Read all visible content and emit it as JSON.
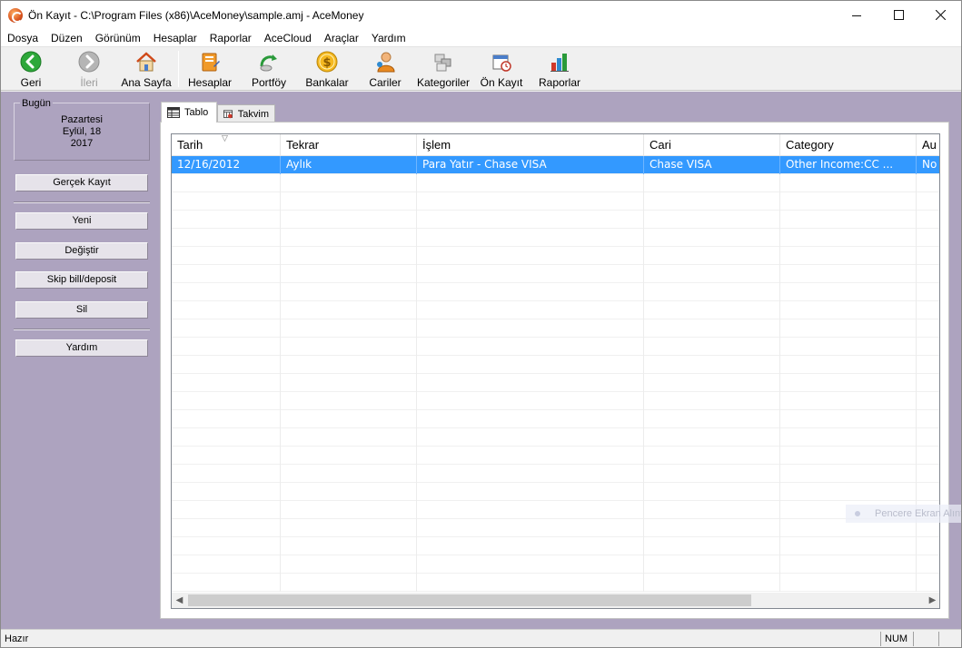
{
  "window": {
    "title": "Ön Kayıt - C:\\Program Files (x86)\\AceMoney\\sample.amj - AceMoney"
  },
  "menu": [
    "Dosya",
    "Düzen",
    "Görünüm",
    "Hesaplar",
    "Raporlar",
    "AceCloud",
    "Araçlar",
    "Yardım"
  ],
  "toolbar": {
    "back": "Geri",
    "forward": "İleri",
    "home": "Ana Sayfa",
    "accounts": "Hesaplar",
    "portfolio": "Portföy",
    "banks": "Bankalar",
    "payees": "Cariler",
    "categories": "Kategoriler",
    "scheduled": "Ön Kayıt",
    "reports": "Raporlar"
  },
  "sidebar": {
    "today_label": "Bugün",
    "weekday": "Pazartesi",
    "date_line": "Eylül, 18",
    "year": "2017",
    "enter_button": "Gerçek Kayıt",
    "new_button": "Yeni",
    "edit_button": "Değiştir",
    "skip_button": "Skip bill/deposit",
    "delete_button": "Sil",
    "help_button": "Yardım"
  },
  "tabs": {
    "table": "Tablo",
    "calendar": "Takvim"
  },
  "table": {
    "columns": [
      "Tarih",
      "Tekrar",
      "İşlem",
      "Cari",
      "Category",
      "Au"
    ],
    "rows": [
      [
        "12/16/2012",
        "Aylık",
        "Para Yatır - Chase VISA",
        "Chase VISA",
        "Other Income:CC ...",
        "No"
      ]
    ]
  },
  "overlay": {
    "watermark": "Pencere Ekran Alıntısı"
  },
  "status": {
    "text": "Hazır",
    "num": "NUM"
  }
}
